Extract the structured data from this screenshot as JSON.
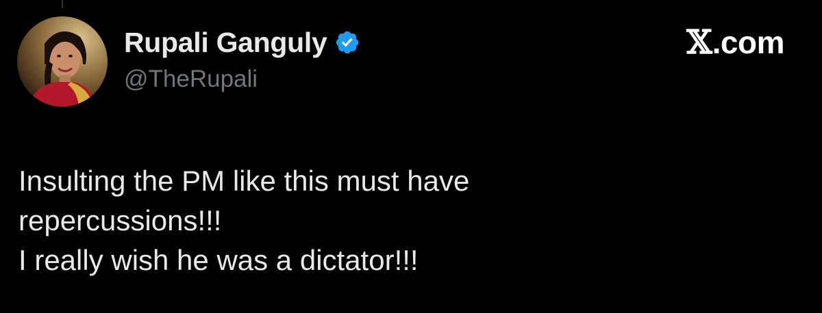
{
  "author": {
    "display_name": "Rupali Ganguly",
    "handle": "@TheRupali",
    "verified": true,
    "avatar_icon": "profile-photo",
    "verified_icon": "verified-badge-icon",
    "verified_color": "#1d9bf0"
  },
  "brand": {
    "x_glyph": "𝕏",
    "suffix": ".com"
  },
  "tweet": {
    "lines": [
      "Insulting the PM like this must have",
      "repercussions!!!",
      "I really wish he was a dictator!!!"
    ]
  },
  "colors": {
    "background": "#000000",
    "primary_text": "#e7e9ea",
    "secondary_text": "#71767b"
  }
}
